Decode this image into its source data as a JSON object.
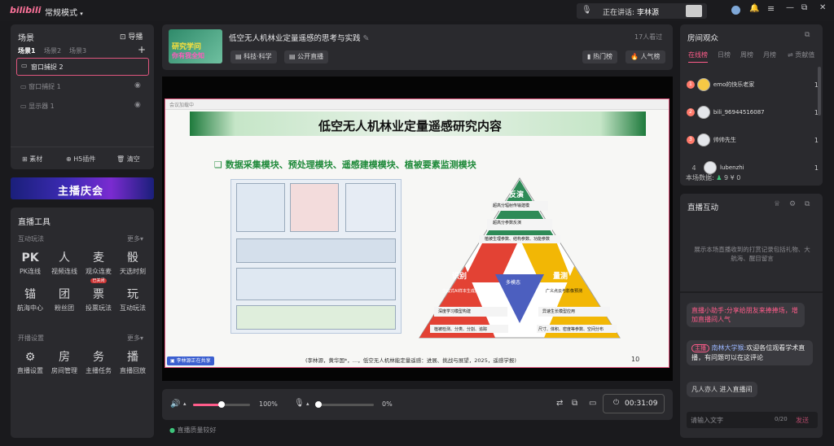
{
  "app": {
    "logo": "bilibili",
    "mode": "常规模式",
    "speaking_label": "正在讲话:",
    "speaking_name": "李林源",
    "win_min": "—",
    "win_max": "□",
    "win_restore": "⧉",
    "win_close": "✕"
  },
  "scenes": {
    "title": "场景",
    "guide": "导播",
    "tabs": [
      "场景1",
      "场景2",
      "场景3"
    ],
    "add": "+",
    "sources": [
      {
        "label": "窗口捕捉 2"
      },
      {
        "label": "窗口捕捉 1"
      },
      {
        "label": "显示器 1"
      }
    ],
    "bottom": [
      "素材",
      "H5插件",
      "清空"
    ]
  },
  "banner": {
    "text": "主播庆会"
  },
  "tools": {
    "title": "直播工具",
    "sec1": "互动玩法",
    "more": "更多",
    "items1": [
      {
        "label": "PK连线",
        "icon": "PK"
      },
      {
        "label": "视频连线",
        "icon": "人"
      },
      {
        "label": "观众连麦",
        "icon": "麦"
      },
      {
        "label": "天选时刻",
        "icon": "骰"
      },
      {
        "label": "航海中心",
        "icon": "锚"
      },
      {
        "label": "粉丝团",
        "icon": "团"
      },
      {
        "label": "投票玩法",
        "icon": "票"
      },
      {
        "label": "互动玩法",
        "icon": "玩"
      }
    ],
    "badge": "已关闭",
    "sec2": "开播设置",
    "items2": [
      {
        "label": "直播设置",
        "icon": "⚙"
      },
      {
        "label": "房间管理",
        "icon": "房"
      },
      {
        "label": "主播任务",
        "icon": "务"
      },
      {
        "label": "直播回放",
        "icon": "播"
      }
    ]
  },
  "stream": {
    "title": "低空无人机林业定量遥感的思考与实践",
    "viewers": "17人看过",
    "tags": [
      "科技·科学",
      "公开直播"
    ],
    "rank1": "热门榜",
    "rank2": "人气榜",
    "cover_text1": "研究学问",
    "cover_text2": "你有我全知"
  },
  "slide": {
    "heading": "低空无人机林业定量遥感研究内容",
    "subheading": "数据采集模块、预处理模块、遥感建模模块、植被要素监测模块",
    "pyr_top": "反演",
    "pyr_left": "识别",
    "pyr_right": "量测",
    "pyr_center": "多模态",
    "cell1": "超高分辐射传输建模",
    "cell2": "超高分参数反演",
    "cell2b": "辐射数据驱动　物理参数驱动",
    "cell3": "植被生理参数、结构参数、功能参数",
    "cell4": "生成式AI样本生成技术",
    "cell5": "深度学习模型构建",
    "cell5b": "目标检测、语义分割、实例分割",
    "cell6": "植被检测、分类、分割、追踪",
    "cell7": "广义点云与影像预测",
    "cell8": "异速生长模型应用",
    "cell8b": "直接量测测量、非直接量测测量",
    "cell9": "尺寸、体积、密度等参数、空间分布",
    "citation": "(李林源，黄华国*，…，低空无人机林能定量遥感：进展、挑战与展望，2025，遥感学报)",
    "page": "10",
    "share": "李林源正在共享",
    "toolbar_left": "会议加载中"
  },
  "controls": {
    "volume_pct": "100%",
    "volume_level": 0.5,
    "mic_pct": "0%",
    "timer": "00:31:09"
  },
  "status": {
    "quality": "直播质量较好"
  },
  "room": {
    "title": "房间观众",
    "tabs": [
      "在线榜",
      "日榜",
      "周榜",
      "月榜",
      "贡献值"
    ],
    "users": [
      {
        "rank": "1",
        "name": "emo的快乐老家",
        "count": "1"
      },
      {
        "rank": "2",
        "name": "bili_96944516087",
        "count": "1"
      },
      {
        "rank": "3",
        "name": "帅帅先生",
        "count": "1"
      },
      {
        "rank": "4",
        "name": "lubenzhi",
        "count": "1"
      }
    ],
    "stats_label": "本场数据:",
    "stat_people": "9",
    "stat_yen": "0"
  },
  "interact": {
    "title": "直播互动",
    "notice": "展示本场直播收到的打赏记录包括礼物、大航海、醒目留言",
    "msgs": [
      {
        "who": "直播小助手:",
        "text": "分享给朋友来捧捧场，增加直播间人气"
      },
      {
        "badge": "主播",
        "who": "南林大学猴:",
        "text": "欢迎各位观看学术直播，有问题可以在这评论"
      },
      {
        "text": "凡人亦人 进入直播间"
      }
    ],
    "input_placeholder": "请输入文字",
    "count": "0/20",
    "send": "发送"
  }
}
